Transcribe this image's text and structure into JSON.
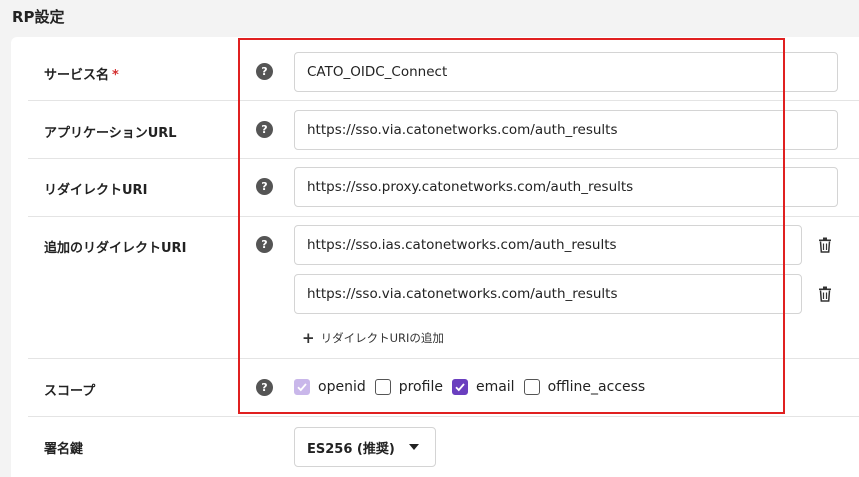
{
  "section_title": "RP設定",
  "rows": {
    "service_name": {
      "label": "サービス名",
      "required_mark": "*",
      "value": "CATO_OIDC_Connect"
    },
    "app_url": {
      "label": "アプリケーションURL",
      "value": "https://sso.via.catonetworks.com/auth_results"
    },
    "redirect_uri": {
      "label": "リダイレクトURI",
      "value": "https://sso.proxy.catonetworks.com/auth_results"
    },
    "additional_redirect": {
      "label": "追加のリダイレクトURI",
      "values": [
        "https://sso.ias.catonetworks.com/auth_results",
        "https://sso.via.catonetworks.com/auth_results"
      ],
      "add_label": "リダイレクトURIの追加"
    },
    "scope": {
      "label": "スコープ",
      "options": [
        {
          "label": "openid",
          "checked": true,
          "disabled": true
        },
        {
          "label": "profile",
          "checked": false
        },
        {
          "label": "email",
          "checked": true
        },
        {
          "label": "offline_access",
          "checked": false
        }
      ]
    },
    "signing_key": {
      "label": "署名鍵",
      "selected": "ES256 (推奨)"
    }
  },
  "help_glyph": "?",
  "colors": {
    "accent": "#6a3fbf",
    "accent_disabled": "#c9b7ea",
    "highlight": "#e02020",
    "required": "#d32f2f"
  }
}
